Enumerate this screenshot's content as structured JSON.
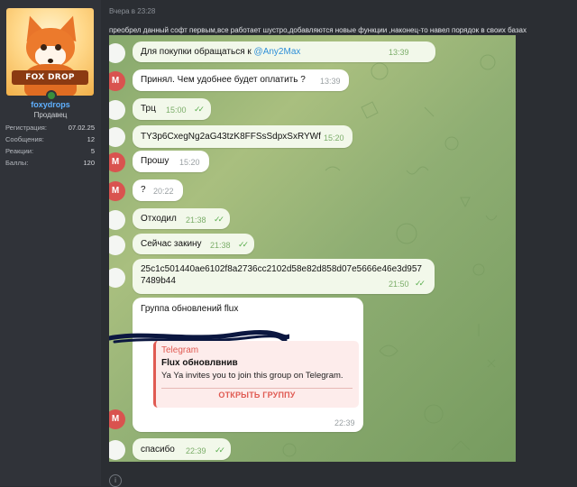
{
  "user": {
    "avatar_caption": "FOX DROP",
    "name": "foxydrops",
    "title": "Продавец",
    "stats": [
      {
        "label": "Регистрация:",
        "value": "07.02.25"
      },
      {
        "label": "Сообщения:",
        "value": "12"
      },
      {
        "label": "Реакции:",
        "value": "5"
      },
      {
        "label": "Баллы:",
        "value": "120"
      }
    ]
  },
  "post": {
    "date": "Вчера в 23:28",
    "text": "преобрел данный софт первым,все работает шустро,добавляются новые функции ,наконец-то навел порядок в своих базах",
    "footer_icon": "info-icon"
  },
  "chat": {
    "messages": [
      {
        "avatar": "",
        "text_prefix": "Для покупки обращаться к ",
        "link": "@Any2Max",
        "time": "13:39",
        "read": false
      },
      {
        "avatar": "M",
        "text": "Принял. Чем удобнее будет оплатить ?",
        "time": "13:39",
        "read": false
      },
      {
        "avatar": "",
        "text": "Трц",
        "time": "15:00",
        "read": true
      },
      {
        "avatar": "",
        "text": "TY3p6CxegNg2aG43tzK8FFSsSdpxSxRYWf",
        "time": "15:20",
        "read": false
      },
      {
        "avatar": "M",
        "text": "Прошу",
        "time": "15:20",
        "read": false
      },
      {
        "avatar": "M",
        "text": "?",
        "time": "20:22",
        "read": false
      },
      {
        "avatar": "",
        "text": "Отходил",
        "time": "21:38",
        "read": true
      },
      {
        "avatar": "",
        "text": "Сейчас закину",
        "time": "21:38",
        "read": true
      },
      {
        "avatar": "",
        "text_line1": "25c1c501440ae6102f8a2736cc2102d58e82d858d07e5666e46e3d957",
        "text_line2": "7489b44",
        "time": "21:50",
        "read": true
      },
      {
        "avatar": "M",
        "text": "Группа обновлений flux",
        "time": "22:39",
        "read": false,
        "preview": {
          "site": "Telegram",
          "title": "Flux обновлвнив",
          "description": "Ya Ya invites you to join this group on Telegram.",
          "button": "ОТКРЫТЬ ГРУППУ"
        }
      },
      {
        "avatar": "",
        "text": "спасибо",
        "time": "22:39",
        "read": true
      }
    ]
  }
}
